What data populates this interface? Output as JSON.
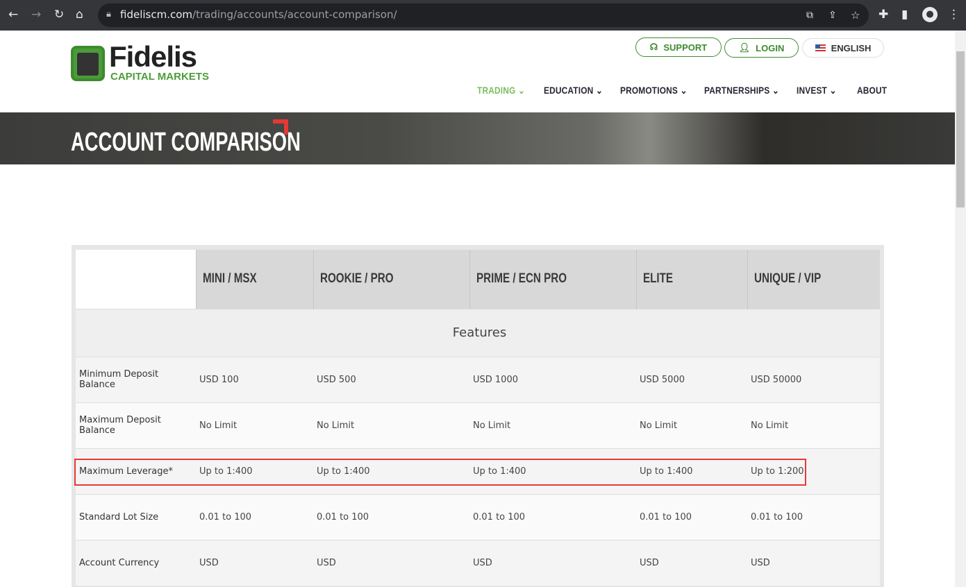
{
  "browser": {
    "url_domain": "fideliscm.com",
    "url_path": "/trading/accounts/account-comparison/"
  },
  "header": {
    "logo_name": "Fidelis",
    "logo_sub": "CAPITAL MARKETS",
    "support": "SUPPORT",
    "login": "LOGIN",
    "language": "ENGLISH",
    "nav": [
      {
        "label": "TRADING",
        "active": true
      },
      {
        "label": "EDUCATION"
      },
      {
        "label": "PROMOTIONS"
      },
      {
        "label": "PARTNERSHIPS"
      },
      {
        "label": "INVEST"
      },
      {
        "label": "ABOUT"
      }
    ]
  },
  "hero": {
    "title": "ACCOUNT COMPARISON"
  },
  "table": {
    "columns": [
      "MINI / MSX",
      "ROOKIE / PRO",
      "PRIME / ECN PRO",
      "ELITE",
      "UNIQUE / VIP"
    ],
    "section": "Features",
    "rows": [
      {
        "label": "Minimum Deposit Balance",
        "values": [
          "USD 100",
          "USD 500",
          "USD 1000",
          "USD 5000",
          "USD 50000"
        ]
      },
      {
        "label": "Maximum Deposit Balance",
        "values": [
          "No Limit",
          "No Limit",
          "No Limit",
          "No Limit",
          "No Limit"
        ]
      },
      {
        "label": "Maximum Leverage*",
        "values": [
          "Up to 1:400",
          "Up to 1:400",
          "Up to 1:400",
          "Up to 1:400",
          "Up to 1:200"
        ],
        "highlighted": true
      },
      {
        "label": "Standard Lot Size",
        "values": [
          "0.01 to 100",
          "0.01 to 100",
          "0.01 to 100",
          "0.01 to 100",
          "0.01 to 100"
        ]
      },
      {
        "label": "Account Currency",
        "values": [
          "USD",
          "USD",
          "USD",
          "USD",
          "USD"
        ]
      }
    ]
  },
  "colors": {
    "brand_green": "#3d8b2e",
    "active_nav": "#7bbf5e",
    "highlight": "#e53935"
  }
}
